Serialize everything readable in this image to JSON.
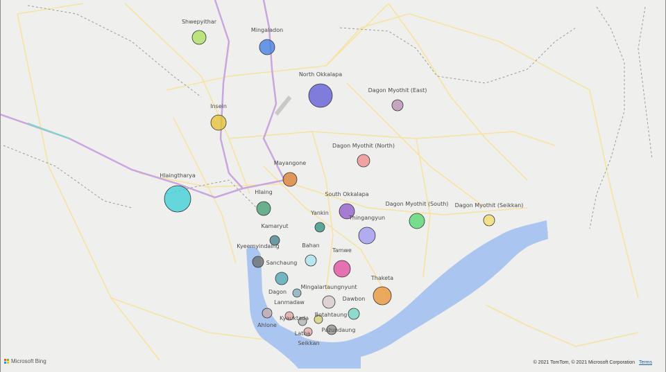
{
  "map": {
    "attribution": "© 2021 TomTom, © 2021 Microsoft Corporation",
    "terms_label": "Terms",
    "logo_label": "Microsoft Bing",
    "colors": {
      "land": "#efefed",
      "water": "#a9c5f0",
      "road": "#f6e3a1",
      "rail": "#c9a6dd",
      "boundary": "#9a9a9a"
    },
    "bubbles": [
      {
        "name": "Shwepyithar",
        "color": "#a9e05a"
      },
      {
        "name": "Mingaladon",
        "color": "#3b7be0"
      },
      {
        "name": "North Okkalapa",
        "color": "#5b55d6"
      },
      {
        "name": "Dagon Myothit (East)",
        "color": "#b98cb0"
      },
      {
        "name": "Insein",
        "color": "#e3c12c"
      },
      {
        "name": "Dagon Myothit (North)",
        "color": "#f08a8a"
      },
      {
        "name": "Mayangone",
        "color": "#d9792a"
      },
      {
        "name": "Hlaingtharya",
        "color": "#37cdd6"
      },
      {
        "name": "Hlaing",
        "color": "#3f9b6e"
      },
      {
        "name": "South Okkalapa",
        "color": "#8e55c9"
      },
      {
        "name": "Dagon Myothit (South)",
        "color": "#4fd66b"
      },
      {
        "name": "Dagon Myothit (Seikkan)",
        "color": "#f3dc6a"
      },
      {
        "name": "Yankin",
        "color": "#2c8f7e"
      },
      {
        "name": "Thingangyun",
        "color": "#9b95ef"
      },
      {
        "name": "Kamaryut",
        "color": "#3d7d8a"
      },
      {
        "name": "Kyeemyindaing",
        "color": "#6a6a6a"
      },
      {
        "name": "Bahan",
        "color": "#a6e3e8"
      },
      {
        "name": "Tamwe",
        "color": "#e0489b"
      },
      {
        "name": "Sanchaung",
        "color": "#4aa3b3"
      },
      {
        "name": "Thaketa",
        "color": "#e8922f"
      },
      {
        "name": "Mingalartaungnyunt",
        "color": "#d9c8c8"
      },
      {
        "name": "Dagon",
        "color": "#7fa9b8"
      },
      {
        "name": "Lanmadaw",
        "color": "#e0a1a1"
      },
      {
        "name": "Dawbon",
        "color": "#6fd3c0"
      },
      {
        "name": "Ahlone",
        "color": "#c9a9a9"
      },
      {
        "name": "Kyauktada",
        "color": "#b0b0b0"
      },
      {
        "name": "Botahtaung",
        "color": "#d6cf70"
      },
      {
        "name": "Pazundaung",
        "color": "#8a8a8a"
      },
      {
        "name": "Latha",
        "color": "#e6a6a6"
      },
      {
        "name": "Seikkan",
        "color": ""
      }
    ]
  }
}
